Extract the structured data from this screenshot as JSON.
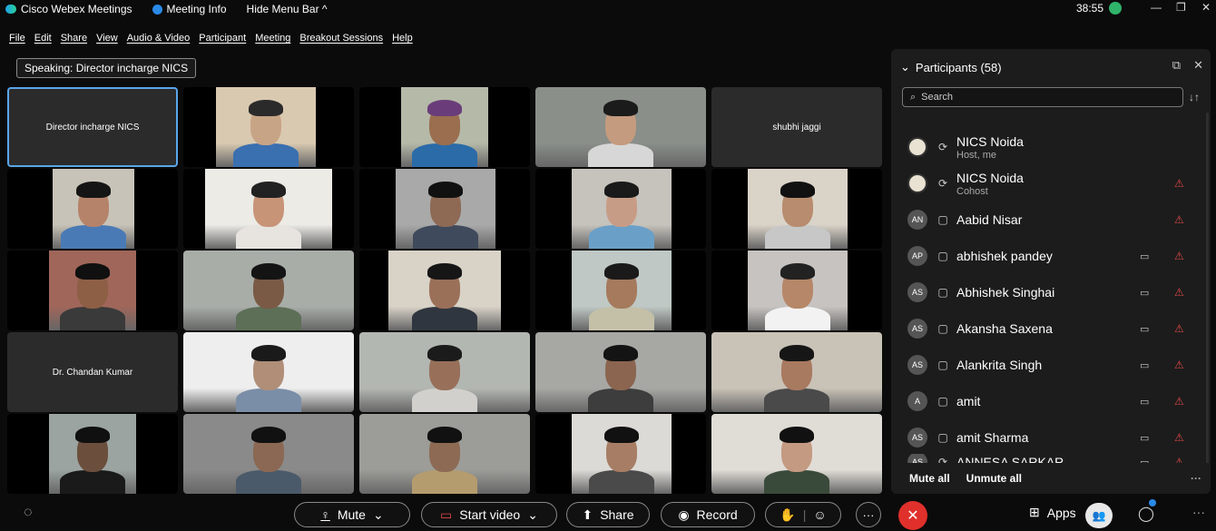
{
  "titlebar": {
    "app_title": "Cisco Webex Meetings",
    "meeting_info": "Meeting Info",
    "hide_menu": "Hide Menu Bar ^",
    "timer": "38:55"
  },
  "menu": [
    "File",
    "Edit",
    "Share",
    "View",
    "Audio & Video",
    "Participant",
    "Meeting",
    "Breakout Sessions",
    "Help"
  ],
  "speaking": "Speaking: Director incharge NICS",
  "tiles": {
    "director": "Director incharge NICS",
    "shubhi": "shubhi jaggi",
    "chandan": "Dr. Chandan Kumar"
  },
  "participants_panel": {
    "title": "Participants (58)",
    "search_placeholder": "Search",
    "rows": [
      {
        "initials": "",
        "name": "NICS Noida",
        "sub": "Host, me"
      },
      {
        "initials": "",
        "name": "NICS Noida",
        "sub": "Cohost"
      },
      {
        "initials": "AN",
        "name": "Aabid Nisar",
        "sub": ""
      },
      {
        "initials": "AP",
        "name": "abhishek pandey",
        "sub": ""
      },
      {
        "initials": "AS",
        "name": "Abhishek Singhai",
        "sub": ""
      },
      {
        "initials": "AS",
        "name": "Akansha Saxena",
        "sub": ""
      },
      {
        "initials": "AS",
        "name": "Alankrita Singh",
        "sub": ""
      },
      {
        "initials": "A",
        "name": "amit",
        "sub": ""
      },
      {
        "initials": "AS",
        "name": "amit Sharma",
        "sub": ""
      },
      {
        "initials": "AS",
        "name": "ANNESA SARKAR",
        "sub": ""
      }
    ],
    "mute_all": "Mute all",
    "unmute_all": "Unmute all"
  },
  "controls": {
    "mute": "Mute",
    "start_video": "Start video",
    "share": "Share",
    "record": "Record",
    "apps": "Apps"
  },
  "colors": {
    "leave": "#e0302b",
    "accent": "#5aa6e8",
    "mic_off": "#e04848"
  }
}
